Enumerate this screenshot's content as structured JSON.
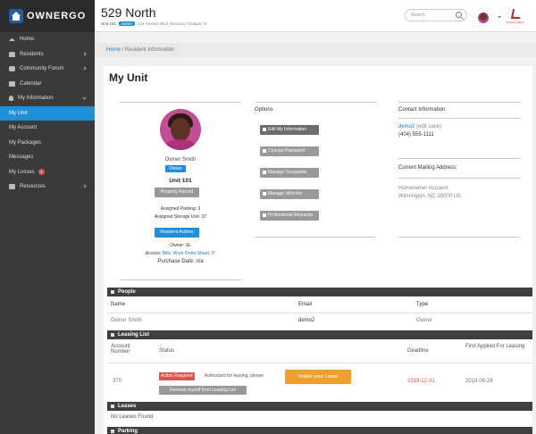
{
  "app": {
    "logo_text": "OWNERGO"
  },
  "header": {
    "building": "529 North",
    "unit_label": "Unit 101",
    "role_badge": "owner",
    "address_line": "123 Aenean Blvd, Bodonia Tristique, IA",
    "search_placeholder": "Search",
    "partner_text": "Property Mgmt"
  },
  "sidebar": {
    "items": [
      {
        "label": "Home"
      },
      {
        "label": "Residents"
      },
      {
        "label": "Community Forum"
      },
      {
        "label": "Calendar"
      },
      {
        "label": "My Information"
      },
      {
        "label": "My Unit"
      },
      {
        "label": "My Account"
      },
      {
        "label": "My Packages"
      },
      {
        "label": "Messages"
      },
      {
        "label": "My Losses",
        "count": "1"
      },
      {
        "label": "Resources"
      }
    ]
  },
  "breadcrumb": {
    "home": "Home",
    "sep": "/",
    "current": "Resident Information"
  },
  "page": {
    "title": "My Unit"
  },
  "profile": {
    "name": "Owner Smith",
    "badge": "Owner",
    "unit": "Unit 101",
    "property_btn": "Property Record",
    "assigned_parking": "Assigned Parking: 3",
    "assigned_storage": "Assigned Storage Unit: 37",
    "resident_btn": "Resident Actions",
    "owner_line": "Owner: SL",
    "access_label": "Access:",
    "access_value": "Bills, Work Order Sheet, IT",
    "purchase_date": "Purchase Date: n/a"
  },
  "options": {
    "heading": "Options",
    "buttons": [
      "Edit My Information",
      "Change Password",
      "Manage Occupants",
      "Manage Vehicles",
      "Professional Requests"
    ]
  },
  "contact": {
    "heading": "Contact Information",
    "email_link": "demo2",
    "email_rest": " (edit save)",
    "phone": "(404) 555-1111",
    "mailing_heading": "Current Mailing Address:",
    "mailing_line1": "Homeowner Account",
    "mailing_line2": "Wilmington, NC 28000 US"
  },
  "people": {
    "heading": "People",
    "columns": [
      "Name",
      "Email",
      "Type"
    ],
    "rows": [
      {
        "name": "Owner Smith",
        "email": "demo2",
        "type": "Owner"
      }
    ]
  },
  "leasing": {
    "heading": "Leasing List",
    "columns": [
      "Account Number",
      "Status",
      "Deadline",
      "First Applied For Leasing"
    ],
    "row": {
      "account": "370",
      "status_badge": "Action Required",
      "status_text": "Authorized for leasing, please",
      "action_btn": "Initiate your Lease",
      "deadline": "2019-12-31",
      "first_applied": "2018-06-28",
      "remove_btn": "Remove myself from Leasing List"
    }
  },
  "leases": {
    "heading": "Leases",
    "empty": "No Leases Found"
  },
  "parking": {
    "heading": "Parking"
  }
}
